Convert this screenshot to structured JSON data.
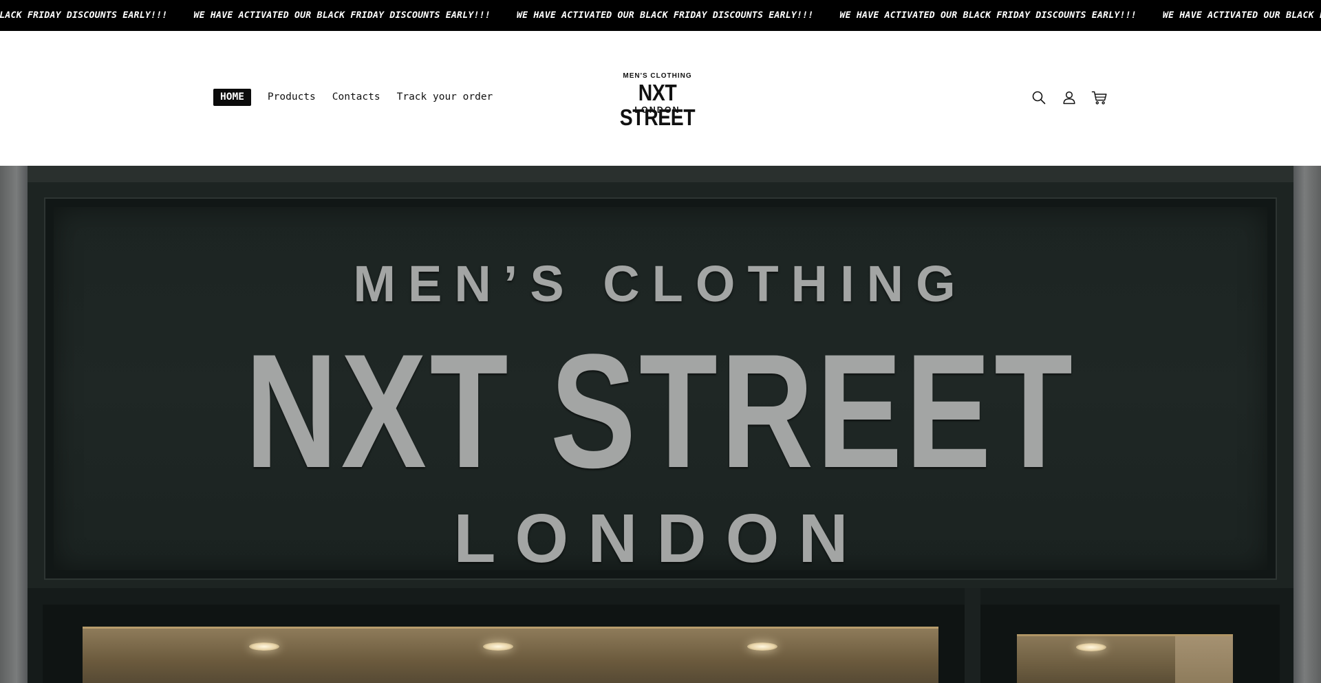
{
  "announcement": {
    "text": "WE HAVE ACTIVATED OUR BLACK FRIDAY DISCOUNTS EARLY!!!",
    "items": [
      "WE HAVE ACTIVATED OUR BLACK FRIDAY DISCOUNTS EARLY!!!",
      "WE HAVE ACTIVATED OUR BLACK FRIDAY DISCOUNTS EARLY!!!",
      "WE HAVE ACTIVATED OUR BLACK FRIDAY DISCOUNTS EARLY!!!",
      "WE HAVE ACTIVATED OUR BLACK FRIDAY DISCOUNTS EARLY!!!",
      "WE HAVE ACTIVATED OUR BLACK FRIDAY DISCOUNTS EARLY!!!"
    ]
  },
  "nav": {
    "items": [
      {
        "label": "HOME",
        "active": true
      },
      {
        "label": "Products",
        "active": false
      },
      {
        "label": "Contacts",
        "active": false
      },
      {
        "label": "Track your order",
        "active": false
      }
    ]
  },
  "logo": {
    "top": "MEN'S CLOTHING",
    "main": "NXT STREET",
    "bottom": "LONDON"
  },
  "header_icons": [
    "search-icon",
    "account-icon",
    "cart-icon"
  ],
  "hero": {
    "sign_top": "MEN’S CLOTHING",
    "sign_main": "NXT STREET",
    "sign_bottom": "LONDON"
  },
  "colors": {
    "announcement_bg": "#000000",
    "nav_active_bg": "#0b0b0b",
    "sign_letter": "#a3a5a4",
    "facade": "#1d2422"
  }
}
